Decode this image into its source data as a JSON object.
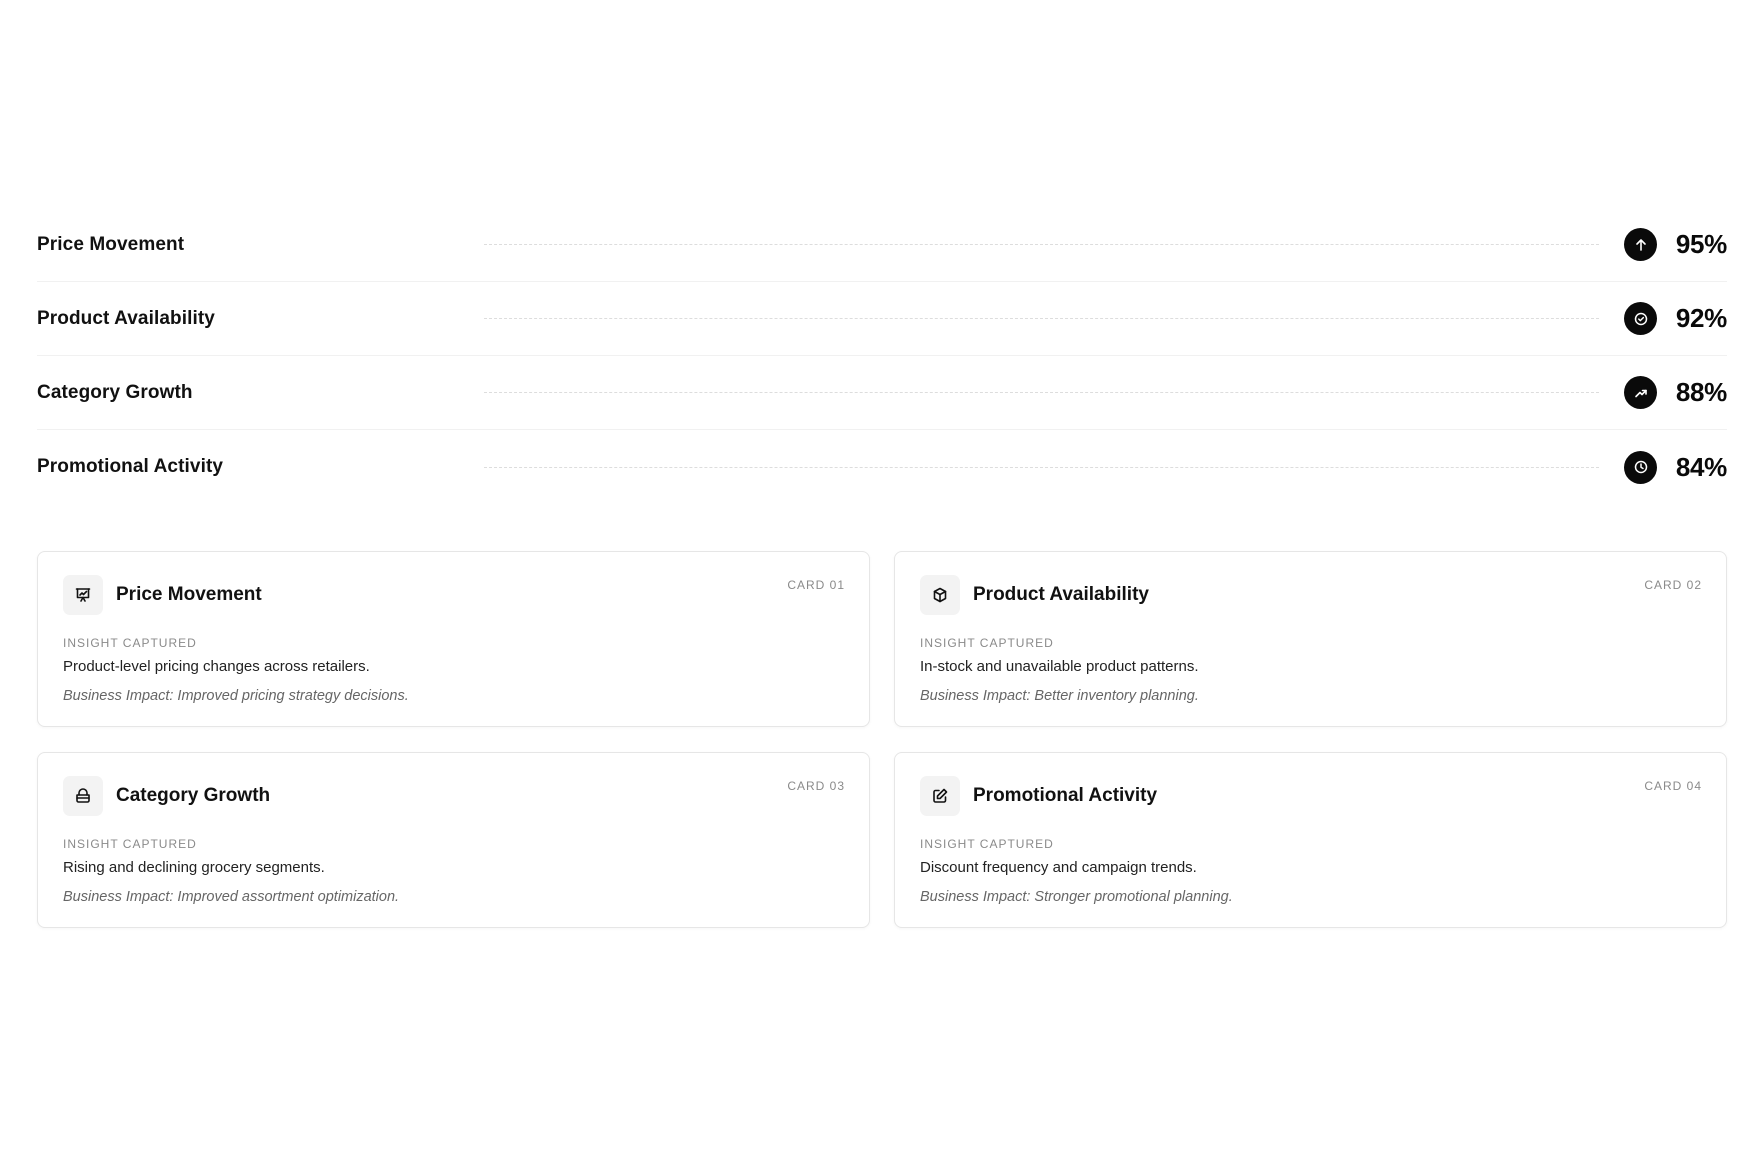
{
  "metrics": [
    {
      "label": "Price Movement",
      "value": "95%",
      "icon": "arrow-up-icon"
    },
    {
      "label": "Product Availability",
      "value": "92%",
      "icon": "check-circle-icon"
    },
    {
      "label": "Category Growth",
      "value": "88%",
      "icon": "trending-up-icon"
    },
    {
      "label": "Promotional Activity",
      "value": "84%",
      "icon": "clock-icon"
    }
  ],
  "cards": [
    {
      "tag": "CARD 01",
      "title": "Price Movement",
      "icon": "presentation-chart-icon",
      "caption": "INSIGHT CAPTURED",
      "description": "Product-level pricing changes across retailers.",
      "impact": "Business Impact: Improved pricing strategy decisions."
    },
    {
      "tag": "CARD 02",
      "title": "Product Availability",
      "icon": "box-icon",
      "caption": "INSIGHT CAPTURED",
      "description": "In-stock and unavailable product patterns.",
      "impact": "Business Impact: Better inventory planning."
    },
    {
      "tag": "CARD 03",
      "title": "Category Growth",
      "icon": "basket-icon",
      "caption": "INSIGHT CAPTURED",
      "description": "Rising and declining grocery segments.",
      "impact": "Business Impact: Improved assortment optimization."
    },
    {
      "tag": "CARD 04",
      "title": "Promotional Activity",
      "icon": "edit-icon",
      "caption": "INSIGHT CAPTURED",
      "description": "Discount frequency and campaign trends.",
      "impact": "Business Impact: Stronger promotional planning."
    }
  ]
}
